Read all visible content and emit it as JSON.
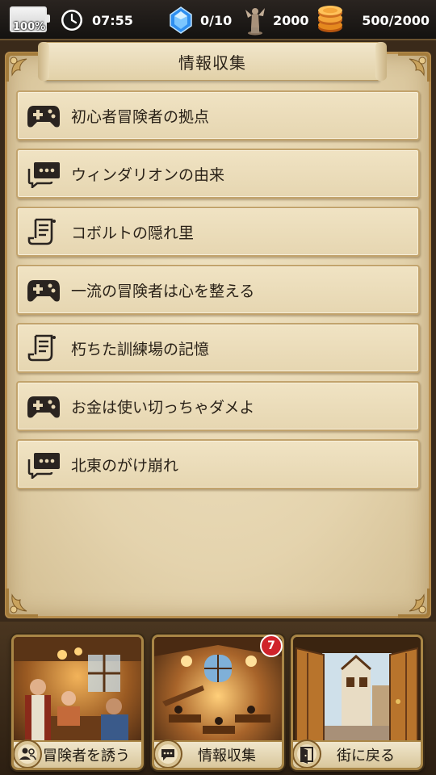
{
  "status_bar": {
    "battery": "100%",
    "time": "07:55",
    "gems": "0/10",
    "renown": "2000",
    "gold": "500/2000"
  },
  "panel": {
    "title": "情報収集"
  },
  "items": [
    {
      "label": "初心者冒険者の拠点",
      "icon": "gamepad-icon"
    },
    {
      "label": "ウィンダリオンの由来",
      "icon": "chat-bubble-icon"
    },
    {
      "label": "コボルトの隠れ里",
      "icon": "scroll-icon"
    },
    {
      "label": "一流の冒険者は心を整える",
      "icon": "gamepad-icon"
    },
    {
      "label": "朽ちた訓練場の記憶",
      "icon": "scroll-icon"
    },
    {
      "label": "お金は使い切っちゃダメよ",
      "icon": "gamepad-icon"
    },
    {
      "label": "北東のがけ崩れ",
      "icon": "chat-bubble-icon"
    }
  ],
  "nav": {
    "recruit_label": "冒険者を誘う",
    "info_label": "情報収集",
    "info_badge": "7",
    "return_label": "街に戻る"
  },
  "colors": {
    "parchment": "#e8d8b4",
    "frame": "#b98f4f",
    "badge": "#d0232b",
    "gem": "#3aa3ff"
  }
}
